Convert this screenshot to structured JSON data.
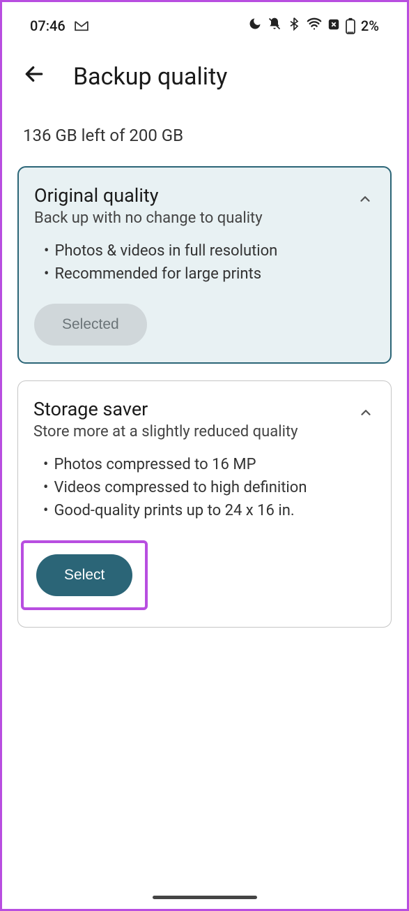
{
  "status": {
    "time": "07:46",
    "battery": "2%"
  },
  "page": {
    "title": "Backup quality",
    "storage_info": "136 GB left of 200 GB"
  },
  "cards": {
    "original": {
      "title": "Original quality",
      "subtitle": "Back up with no change to quality",
      "bullets": {
        "b1": "Photos & videos in full resolution",
        "b2": "Recommended for large prints"
      },
      "button": "Selected"
    },
    "saver": {
      "title": "Storage saver",
      "subtitle": "Store more at a slightly reduced quality",
      "bullets": {
        "b1": "Photos compressed to 16 MP",
        "b2": "Videos compressed to high definition",
        "b3": "Good-quality prints up to 24 x 16 in."
      },
      "button": "Select"
    }
  }
}
